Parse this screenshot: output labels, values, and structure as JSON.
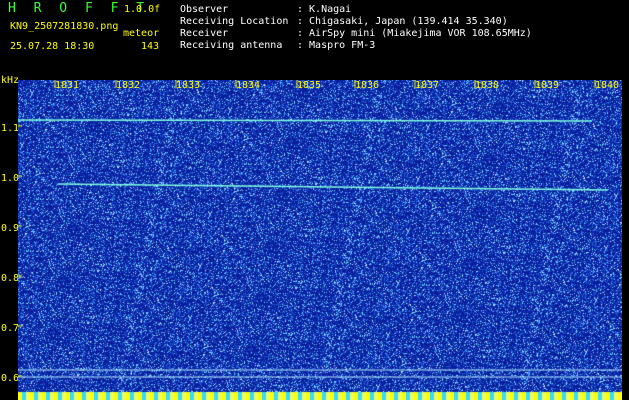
{
  "app": {
    "logo": "H R O F F T",
    "version": "1.0.0f"
  },
  "file": {
    "name": "KN9_2507281830.png",
    "timestamp": "25.07.28 18:30"
  },
  "meteor": {
    "label": "meteor",
    "count": "143"
  },
  "info": [
    {
      "label": "Observer",
      "value": ": K.Nagai"
    },
    {
      "label": "Receiving Location",
      "value": ": Chigasaki, Japan (139.414 35.340)"
    },
    {
      "label": "Receiver",
      "value": ": AirSpy mini (Miakejima VOR 108.65MHz)"
    },
    {
      "label": "Receiving antenna",
      "value": ": Maspro FM-3"
    }
  ],
  "axis": {
    "y_unit": "kHz",
    "y_ticks": [
      "1.1",
      "1.0",
      "0.9",
      "0.8",
      "0.7",
      "0.6"
    ],
    "x_ticks": [
      "1831",
      "1832",
      "1833",
      "1834",
      "1835",
      "1836",
      "1837",
      "1838",
      "1839",
      "1840"
    ]
  },
  "colors": {
    "background": "#0a1e9c",
    "noise": "#6fd0ff",
    "signal": "#7fffe0",
    "axis": "#ffff00",
    "header_green": "#33ff33"
  }
}
